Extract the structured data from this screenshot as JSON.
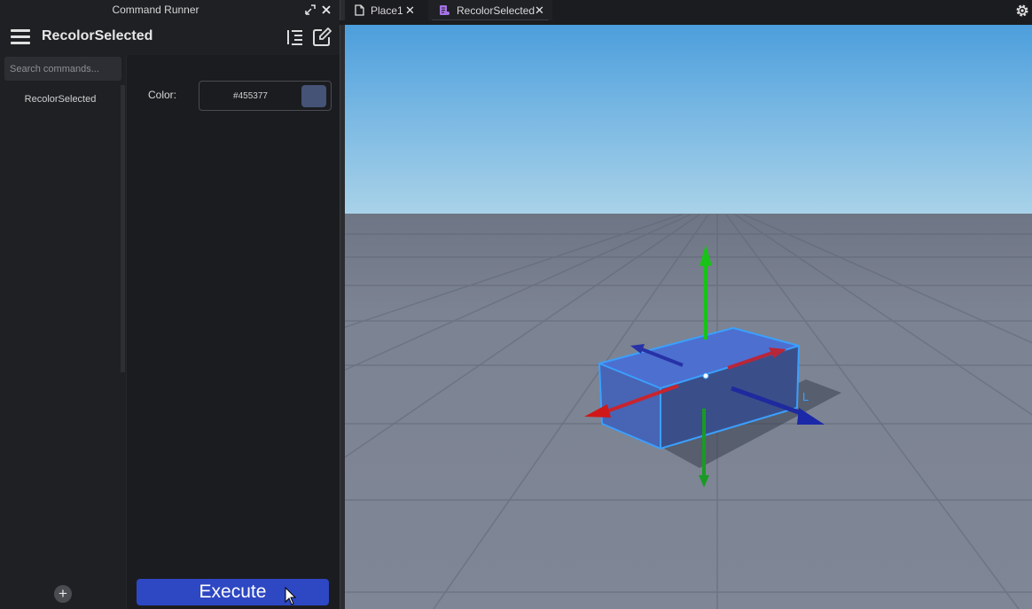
{
  "panel": {
    "title": "Command Runner",
    "command_name": "RecolorSelected",
    "search_placeholder": "Search commands...",
    "commands": [
      {
        "label": "RecolorSelected"
      }
    ],
    "add_label": "+",
    "execute_label": "Execute"
  },
  "form": {
    "color_label": "Color:",
    "color_value": "#455377"
  },
  "tabs": [
    {
      "label": "Place1",
      "icon": "place-file-icon"
    },
    {
      "label": "RecolorSelected",
      "icon": "script-icon"
    }
  ],
  "viewport": {
    "part_color": "#455377",
    "handle_label": "L"
  },
  "colors": {
    "accent": "#2e47c2",
    "swatch": "#455377"
  }
}
